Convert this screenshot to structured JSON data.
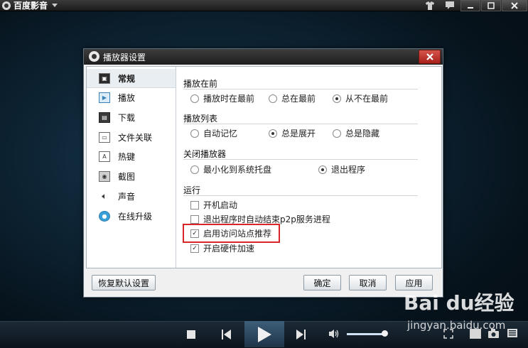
{
  "player": {
    "app_name": "百度影音",
    "bottom_bar": {
      "volume_level": 0.95
    }
  },
  "dialog": {
    "title": "播放器设置",
    "nav": [
      {
        "label": "常规",
        "icon": "general-icon"
      },
      {
        "label": "播放",
        "icon": "play-icon"
      },
      {
        "label": "下载",
        "icon": "download-icon"
      },
      {
        "label": "文件关联",
        "icon": "file-association-icon"
      },
      {
        "label": "热键",
        "icon": "hotkey-icon"
      },
      {
        "label": "截图",
        "icon": "screenshot-icon"
      },
      {
        "label": "声音",
        "icon": "sound-icon"
      },
      {
        "label": "在线升级",
        "icon": "online-upgrade-icon"
      }
    ],
    "sections": {
      "play_front": {
        "title": "播放在前",
        "options": [
          "播放时在最前",
          "总在最前",
          "从不在最前"
        ],
        "selected": 2
      },
      "playlist": {
        "title": "播放列表",
        "options": [
          "自动记忆",
          "总是展开",
          "总是隐藏"
        ],
        "selected": 1
      },
      "close_player": {
        "title": "关闭播放器",
        "options": [
          "最小化到系统托盘",
          "退出程序"
        ],
        "selected": 1
      },
      "run": {
        "title": "运行",
        "checks": [
          {
            "label": "开机启动",
            "checked": false
          },
          {
            "label": "退出程序时自动结束p2p服务进程",
            "checked": false
          },
          {
            "label": "启用访问站点推荐",
            "checked": true
          },
          {
            "label": "开启硬件加速",
            "checked": true
          }
        ]
      }
    },
    "buttons": {
      "restore_default": "恢复默认设置",
      "ok": "确定",
      "cancel": "取消",
      "apply": "应用"
    }
  },
  "watermark": {
    "main": "Bai du经验",
    "sub": "jingyan.baidu.com"
  },
  "colors": {
    "highlight": "#d9262b",
    "close_button": "#c0392b"
  }
}
